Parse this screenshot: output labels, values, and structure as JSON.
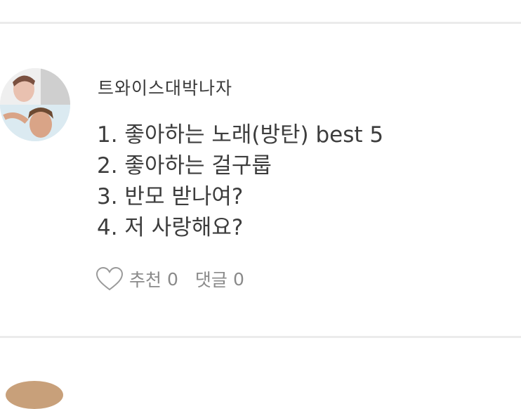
{
  "post": {
    "author": "트와이스대박나자",
    "lines": [
      "1. 좋아하는 노래(방탄) best 5",
      "2. 좋아하는 걸구룹",
      "3. 반모 받나여?",
      "4. 저 사랑해요?"
    ],
    "recommend_label": "추천",
    "recommend_count": "0",
    "comment_label": "댓글",
    "comment_count": "0"
  },
  "icons": {
    "like": "heart-outline-icon"
  },
  "colors": {
    "divider": "#ebebeb",
    "text": "#3d3d3d",
    "meta": "#8a8a8a"
  }
}
